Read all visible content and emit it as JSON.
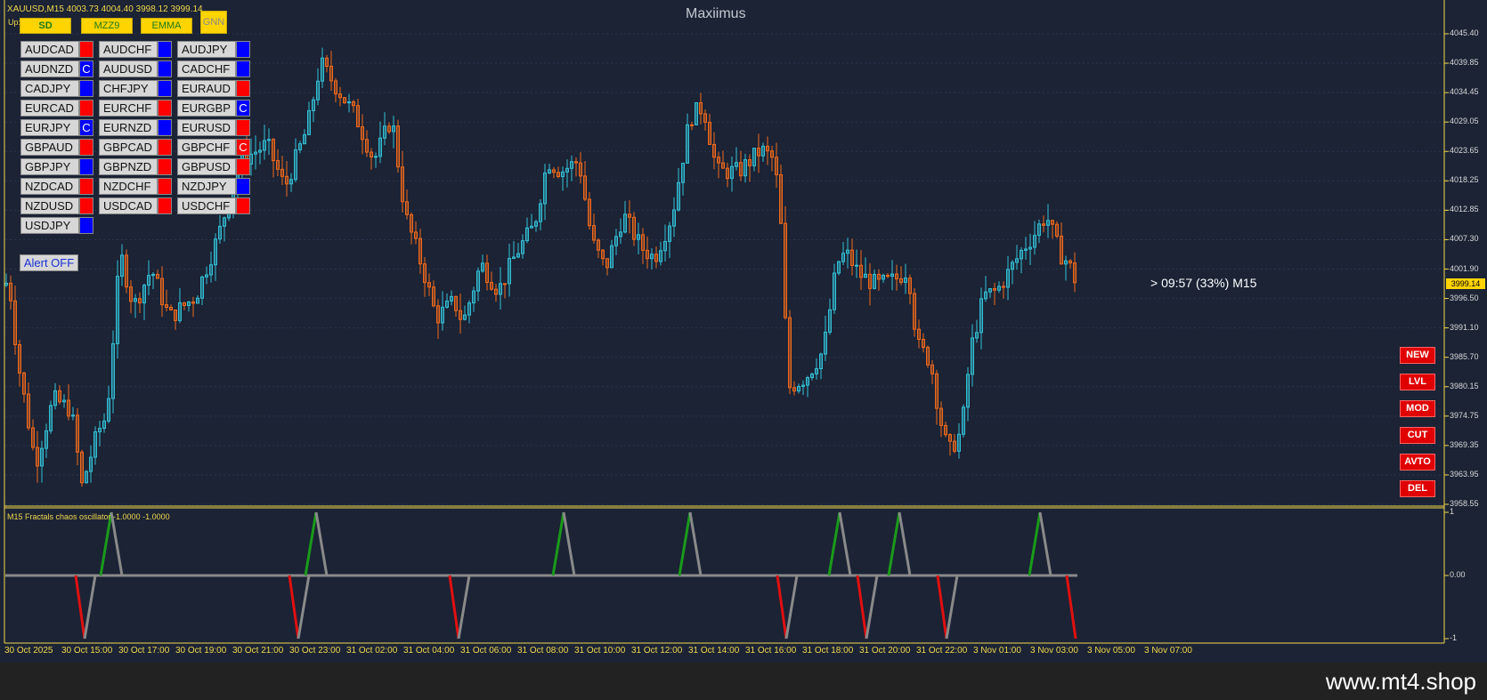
{
  "header": {
    "symbol_info": "XAUUSD,M15  4003.73 4004.40 3998.12 3999.14",
    "up_label": "Up:",
    "title": "Maxiimus"
  },
  "toolbar": [
    {
      "label": "SD"
    },
    {
      "label": "MZZ9"
    },
    {
      "label": "EMMA"
    },
    {
      "label": "GNN"
    }
  ],
  "pairs": [
    {
      "name": "AUDCAD",
      "color": "#ff0000",
      "mark": ""
    },
    {
      "name": "AUDCHF",
      "color": "#0000ff",
      "mark": ""
    },
    {
      "name": "AUDJPY",
      "color": "#0000ff",
      "mark": ""
    },
    {
      "name": "AUDNZD",
      "color": "#0000ff",
      "mark": "C"
    },
    {
      "name": "AUDUSD",
      "color": "#0000ff",
      "mark": ""
    },
    {
      "name": "CADCHF",
      "color": "#0000ff",
      "mark": ""
    },
    {
      "name": "CADJPY",
      "color": "#0000ff",
      "mark": ""
    },
    {
      "name": "CHFJPY",
      "color": "#0000ff",
      "mark": ""
    },
    {
      "name": "EURAUD",
      "color": "#ff0000",
      "mark": ""
    },
    {
      "name": "EURCAD",
      "color": "#ff0000",
      "mark": ""
    },
    {
      "name": "EURCHF",
      "color": "#ff0000",
      "mark": ""
    },
    {
      "name": "EURGBP",
      "color": "#0000ff",
      "mark": "C"
    },
    {
      "name": "EURJPY",
      "color": "#0000ff",
      "mark": "C"
    },
    {
      "name": "EURNZD",
      "color": "#0000ff",
      "mark": ""
    },
    {
      "name": "EURUSD",
      "color": "#ff0000",
      "mark": ""
    },
    {
      "name": "GBPAUD",
      "color": "#ff0000",
      "mark": ""
    },
    {
      "name": "GBPCAD",
      "color": "#ff0000",
      "mark": ""
    },
    {
      "name": "GBPCHF",
      "color": "#ff0000",
      "mark": "C"
    },
    {
      "name": "GBPJPY",
      "color": "#0000ff",
      "mark": ""
    },
    {
      "name": "GBPNZD",
      "color": "#ff0000",
      "mark": ""
    },
    {
      "name": "GBPUSD",
      "color": "#ff0000",
      "mark": ""
    },
    {
      "name": "NZDCAD",
      "color": "#ff0000",
      "mark": ""
    },
    {
      "name": "NZDCHF",
      "color": "#ff0000",
      "mark": ""
    },
    {
      "name": "NZDJPY",
      "color": "#0000ff",
      "mark": ""
    },
    {
      "name": "NZDUSD",
      "color": "#ff0000",
      "mark": ""
    },
    {
      "name": "USDCAD",
      "color": "#ff0000",
      "mark": ""
    },
    {
      "name": "USDCHF",
      "color": "#ff0000",
      "mark": ""
    },
    {
      "name": "USDJPY",
      "color": "#0000ff",
      "mark": ""
    }
  ],
  "alert_button": "Alert OFF",
  "right_buttons": [
    "NEW",
    "LVL",
    "MOD",
    "CUT",
    "AVTO",
    "DEL"
  ],
  "timer_text": "> 09:57 (33%) M15",
  "current_price": "3999.14",
  "price_axis": [
    "4045.40",
    "4039.85",
    "4034.45",
    "4029.05",
    "4023.65",
    "4018.25",
    "4012.85",
    "4007.30",
    "4001.90",
    "3996.50",
    "3991.10",
    "3985.70",
    "3980.15",
    "3974.75",
    "3969.35",
    "3963.95",
    "3958.55"
  ],
  "oscillator": {
    "label": "M15 Fractals chaos oscillator -1.0000 -1.0000",
    "axis": [
      "1",
      "0.00",
      "-1"
    ],
    "up_spikes": [
      125,
      355,
      633,
      775,
      943,
      1010,
      1168
    ],
    "down_spikes": [
      95,
      335,
      515,
      883,
      973,
      1063,
      1208
    ]
  },
  "time_axis": [
    "30 Oct 2025",
    "30 Oct 15:00",
    "30 Oct 17:00",
    "30 Oct 19:00",
    "30 Oct 21:00",
    "30 Oct 23:00",
    "31 Oct 02:00",
    "31 Oct 04:00",
    "31 Oct 06:00",
    "31 Oct 08:00",
    "31 Oct 10:00",
    "31 Oct 12:00",
    "31 Oct 14:00",
    "31 Oct 16:00",
    "31 Oct 18:00",
    "31 Oct 20:00",
    "31 Oct 22:00",
    "3 Nov 01:00",
    "3 Nov 03:00",
    "3 Nov 05:00",
    "3 Nov 07:00"
  ],
  "chart_data": {
    "type": "candlestick",
    "price_range": [
      3958.55,
      4045.4
    ],
    "anchors": [
      [
        0,
        3998
      ],
      [
        10,
        4000
      ],
      [
        20,
        3985
      ],
      [
        40,
        3966
      ],
      [
        60,
        3978
      ],
      [
        80,
        3976
      ],
      [
        92,
        3962
      ],
      [
        110,
        3972
      ],
      [
        120,
        3975
      ],
      [
        135,
        4005
      ],
      [
        150,
        3995
      ],
      [
        170,
        4002
      ],
      [
        190,
        3993
      ],
      [
        220,
        3997
      ],
      [
        245,
        4008
      ],
      [
        270,
        4022
      ],
      [
        300,
        4025
      ],
      [
        320,
        4017
      ],
      [
        345,
        4028
      ],
      [
        360,
        4040
      ],
      [
        380,
        4035
      ],
      [
        400,
        4030
      ],
      [
        420,
        4022
      ],
      [
        440,
        4030
      ],
      [
        455,
        4012
      ],
      [
        475,
        4002
      ],
      [
        490,
        3993
      ],
      [
        510,
        3996
      ],
      [
        520,
        3992
      ],
      [
        540,
        4003
      ],
      [
        560,
        3998
      ],
      [
        580,
        4005
      ],
      [
        600,
        4010
      ],
      [
        615,
        4022
      ],
      [
        630,
        4020
      ],
      [
        650,
        4022
      ],
      [
        665,
        4007
      ],
      [
        680,
        4002
      ],
      [
        700,
        4012
      ],
      [
        720,
        4006
      ],
      [
        735,
        4004
      ],
      [
        755,
        4012
      ],
      [
        775,
        4030
      ],
      [
        790,
        4032
      ],
      [
        805,
        4020
      ],
      [
        830,
        4020
      ],
      [
        855,
        4024
      ],
      [
        870,
        4022
      ],
      [
        878,
        4008
      ],
      [
        885,
        3980
      ],
      [
        905,
        3982
      ],
      [
        925,
        3987
      ],
      [
        940,
        4003
      ],
      [
        950,
        4005
      ],
      [
        965,
        4001
      ],
      [
        985,
        3999
      ],
      [
        1005,
        4000
      ],
      [
        1020,
        4002
      ],
      [
        1030,
        3988
      ],
      [
        1045,
        3985
      ],
      [
        1055,
        3975
      ],
      [
        1065,
        3968
      ],
      [
        1080,
        3972
      ],
      [
        1090,
        3987
      ],
      [
        1105,
        3997
      ],
      [
        1120,
        3998
      ],
      [
        1135,
        4002
      ],
      [
        1150,
        4006
      ],
      [
        1160,
        4008
      ],
      [
        1175,
        4012
      ],
      [
        1190,
        4005
      ],
      [
        1200,
        4003
      ],
      [
        1210,
        3999
      ]
    ]
  }
}
